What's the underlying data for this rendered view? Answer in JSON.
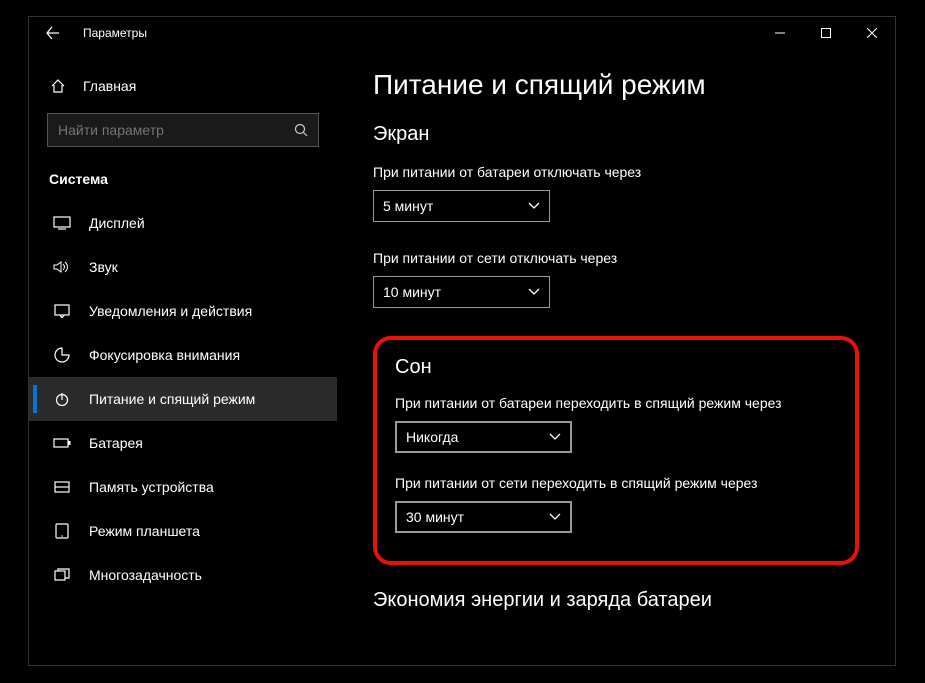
{
  "window_title": "Параметры",
  "home_label": "Главная",
  "search_placeholder": "Найти параметр",
  "sidebar_section": "Система",
  "nav": [
    {
      "label": "Дисплей"
    },
    {
      "label": "Звук"
    },
    {
      "label": "Уведомления и действия"
    },
    {
      "label": "Фокусировка внимания"
    },
    {
      "label": "Питание и спящий режим"
    },
    {
      "label": "Батарея"
    },
    {
      "label": "Память устройства"
    },
    {
      "label": "Режим планшета"
    },
    {
      "label": "Многозадачность"
    }
  ],
  "page_title": "Питание и спящий режим",
  "screen_section": {
    "heading": "Экран",
    "battery_label": "При питании от батареи отключать через",
    "battery_value": "5 минут",
    "ac_label": "При питании от сети отключать через",
    "ac_value": "10 минут"
  },
  "sleep_section": {
    "heading": "Сон",
    "battery_label": "При питании от батареи переходить в спящий режим через",
    "battery_value": "Никогда",
    "ac_label": "При питании от сети переходить в спящий режим через",
    "ac_value": "30 минут"
  },
  "energy_heading": "Экономия энергии и заряда батареи"
}
